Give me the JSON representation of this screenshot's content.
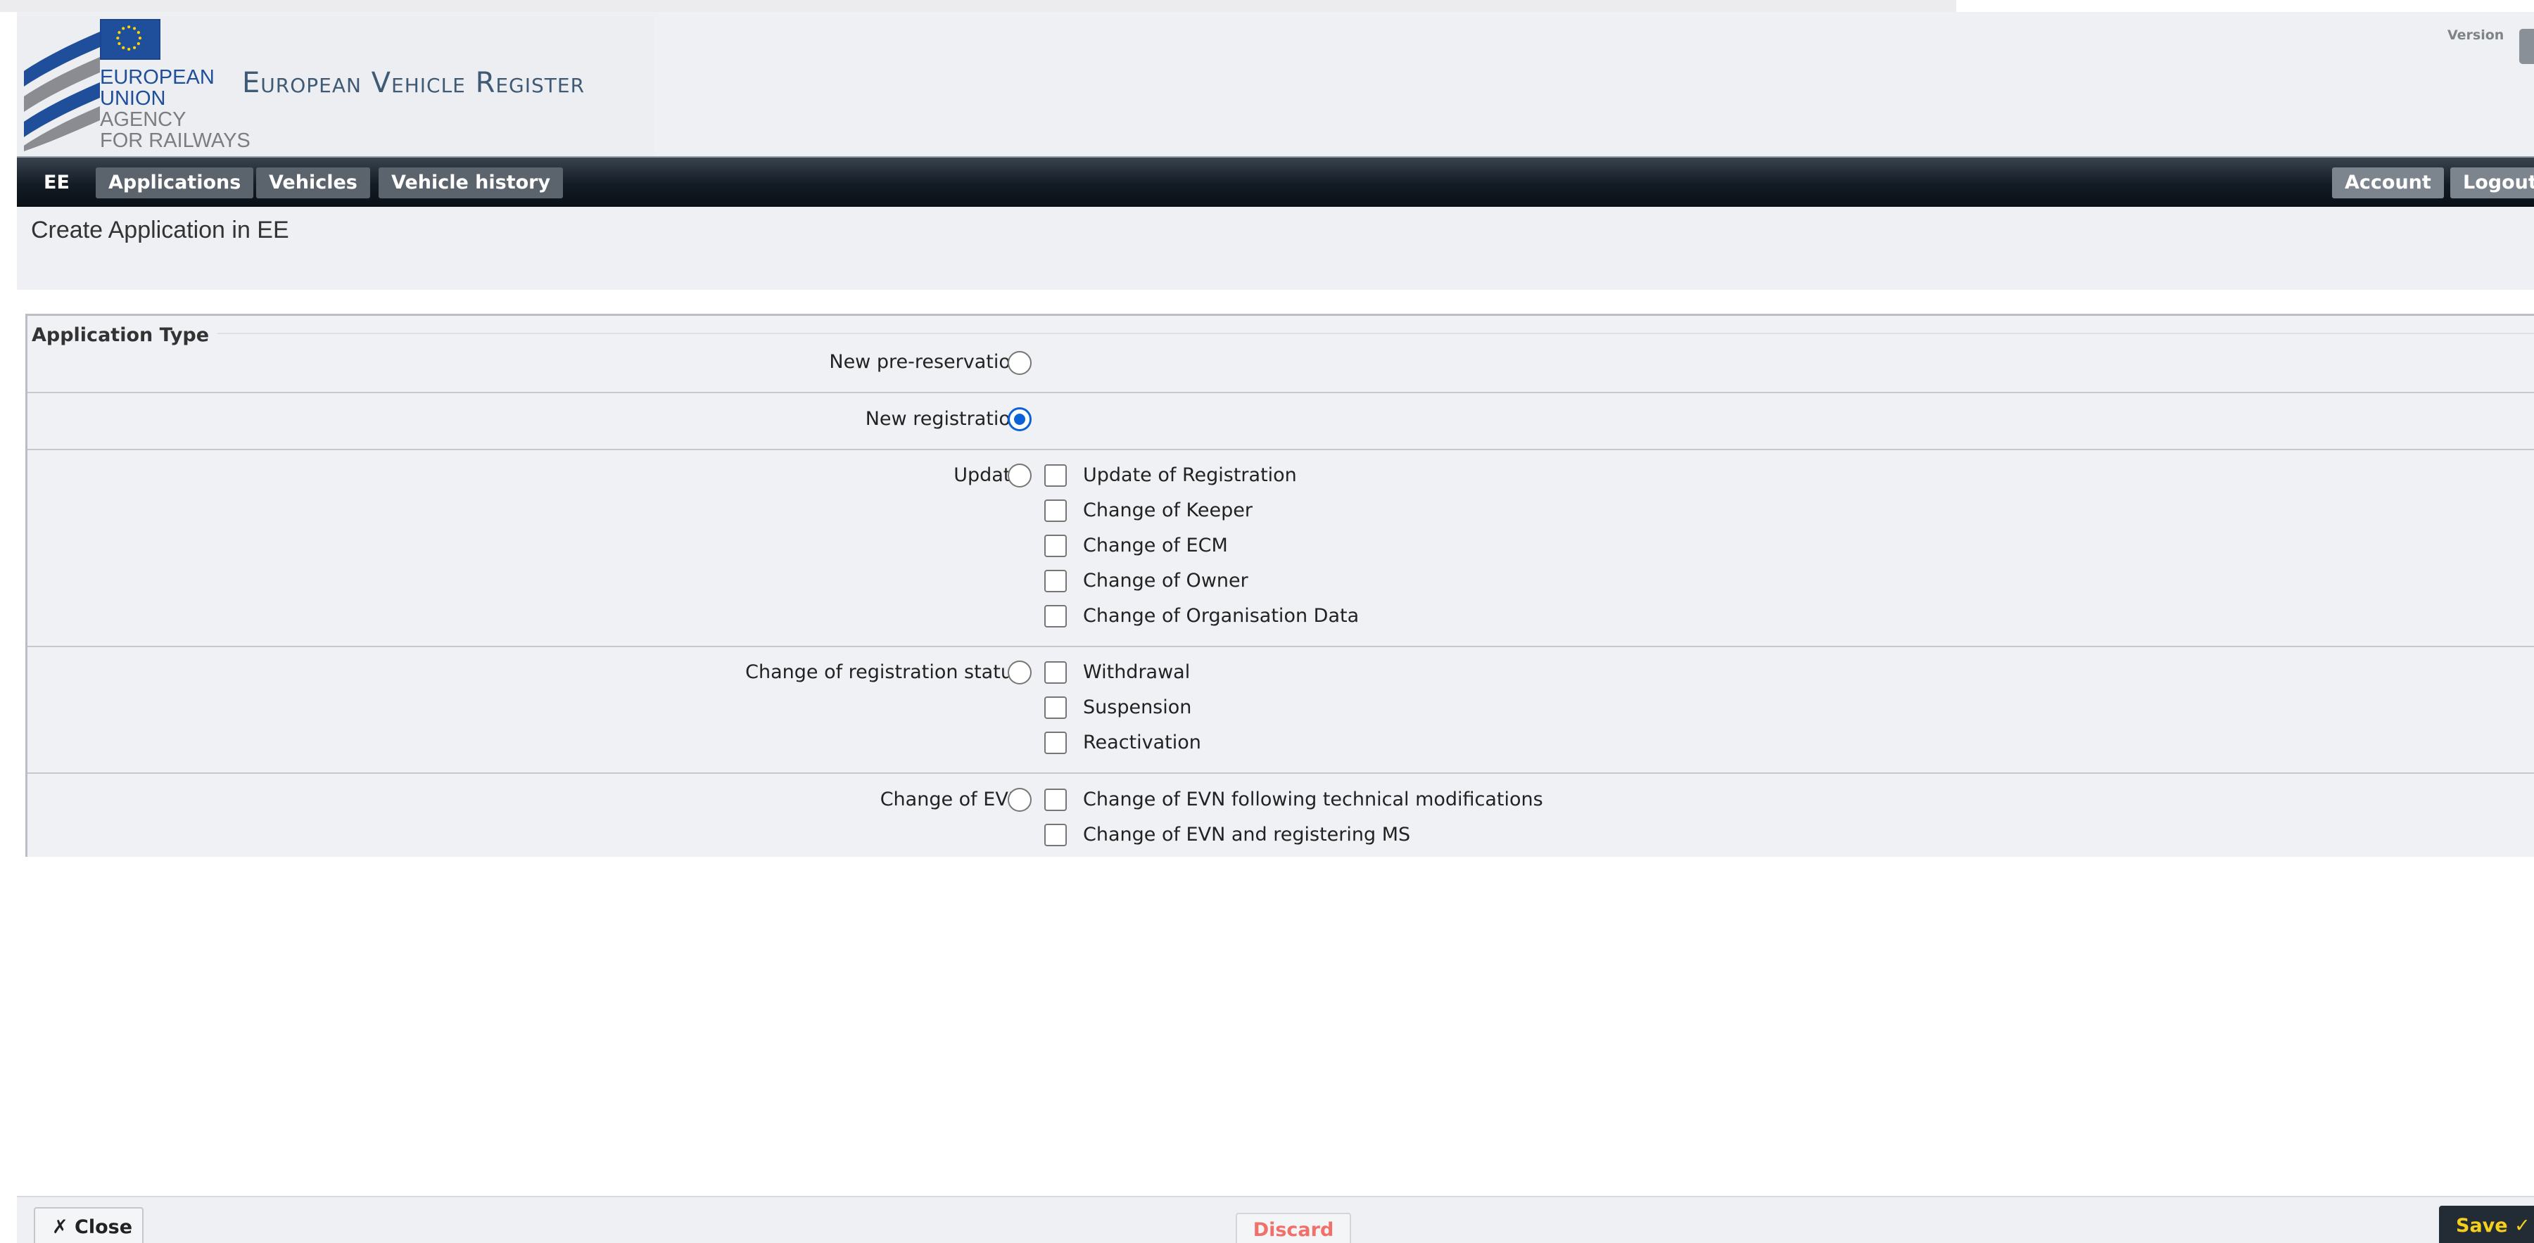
{
  "header": {
    "agency_lines": [
      "EUROPEAN",
      "UNION",
      "AGENCY",
      "FOR RAILWAYS"
    ],
    "app_title": "European Vehicle Register",
    "version_label": "Version"
  },
  "nav": {
    "country": "EE",
    "items": [
      "Applications",
      "Vehicles",
      "Vehicle history"
    ],
    "account": "Account",
    "logout": "Logout"
  },
  "page": {
    "title": "Create Application in EE"
  },
  "form": {
    "legend": "Application Type",
    "options": {
      "new_pre_reservation": {
        "label": "New pre-reservation",
        "checked": false
      },
      "new_registration": {
        "label": "New registration",
        "checked": true
      },
      "update": {
        "label": "Update",
        "checked": false,
        "sub": [
          "Update of Registration",
          "Change of Keeper",
          "Change of ECM",
          "Change of Owner",
          "Change of Organisation Data"
        ]
      },
      "change_status": {
        "label": "Change of registration status",
        "checked": false,
        "sub": [
          "Withdrawal",
          "Suspension",
          "Reactivation"
        ]
      },
      "change_evn": {
        "label": "Change of EVN",
        "checked": false,
        "sub": [
          "Change of EVN following technical modifications",
          "Change of EVN and registering MS"
        ]
      }
    }
  },
  "footer": {
    "close": "✗ Close",
    "discard": "Discard",
    "save": "Save ✓"
  },
  "colors": {
    "accent": "#0b62d6",
    "navbar": "#131b24",
    "save_text": "#f5cf1d",
    "discard_text": "#f0706a"
  }
}
